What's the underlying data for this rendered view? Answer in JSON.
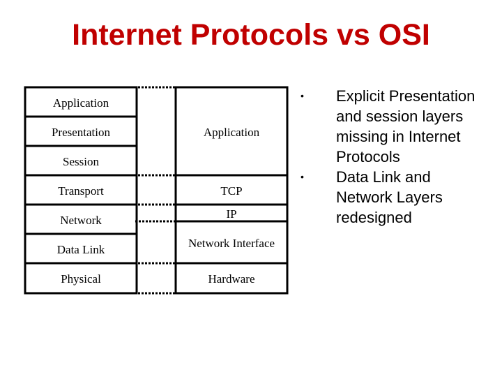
{
  "title": "Internet Protocols vs OSI",
  "title_color": "#c00000",
  "diagram": {
    "osi_layers": [
      "Application",
      "Presentation",
      "Session",
      "Transport",
      "Network",
      "Data Link",
      "Physical"
    ],
    "internet_layers": [
      "Application",
      "TCP",
      "IP",
      "Network Interface",
      "Hardware"
    ]
  },
  "bullets": [
    "Explicit Presentation and session layers missing in Internet Protocols",
    "Data Link and Network Layers redesigned"
  ],
  "bullet_glyph": "•"
}
